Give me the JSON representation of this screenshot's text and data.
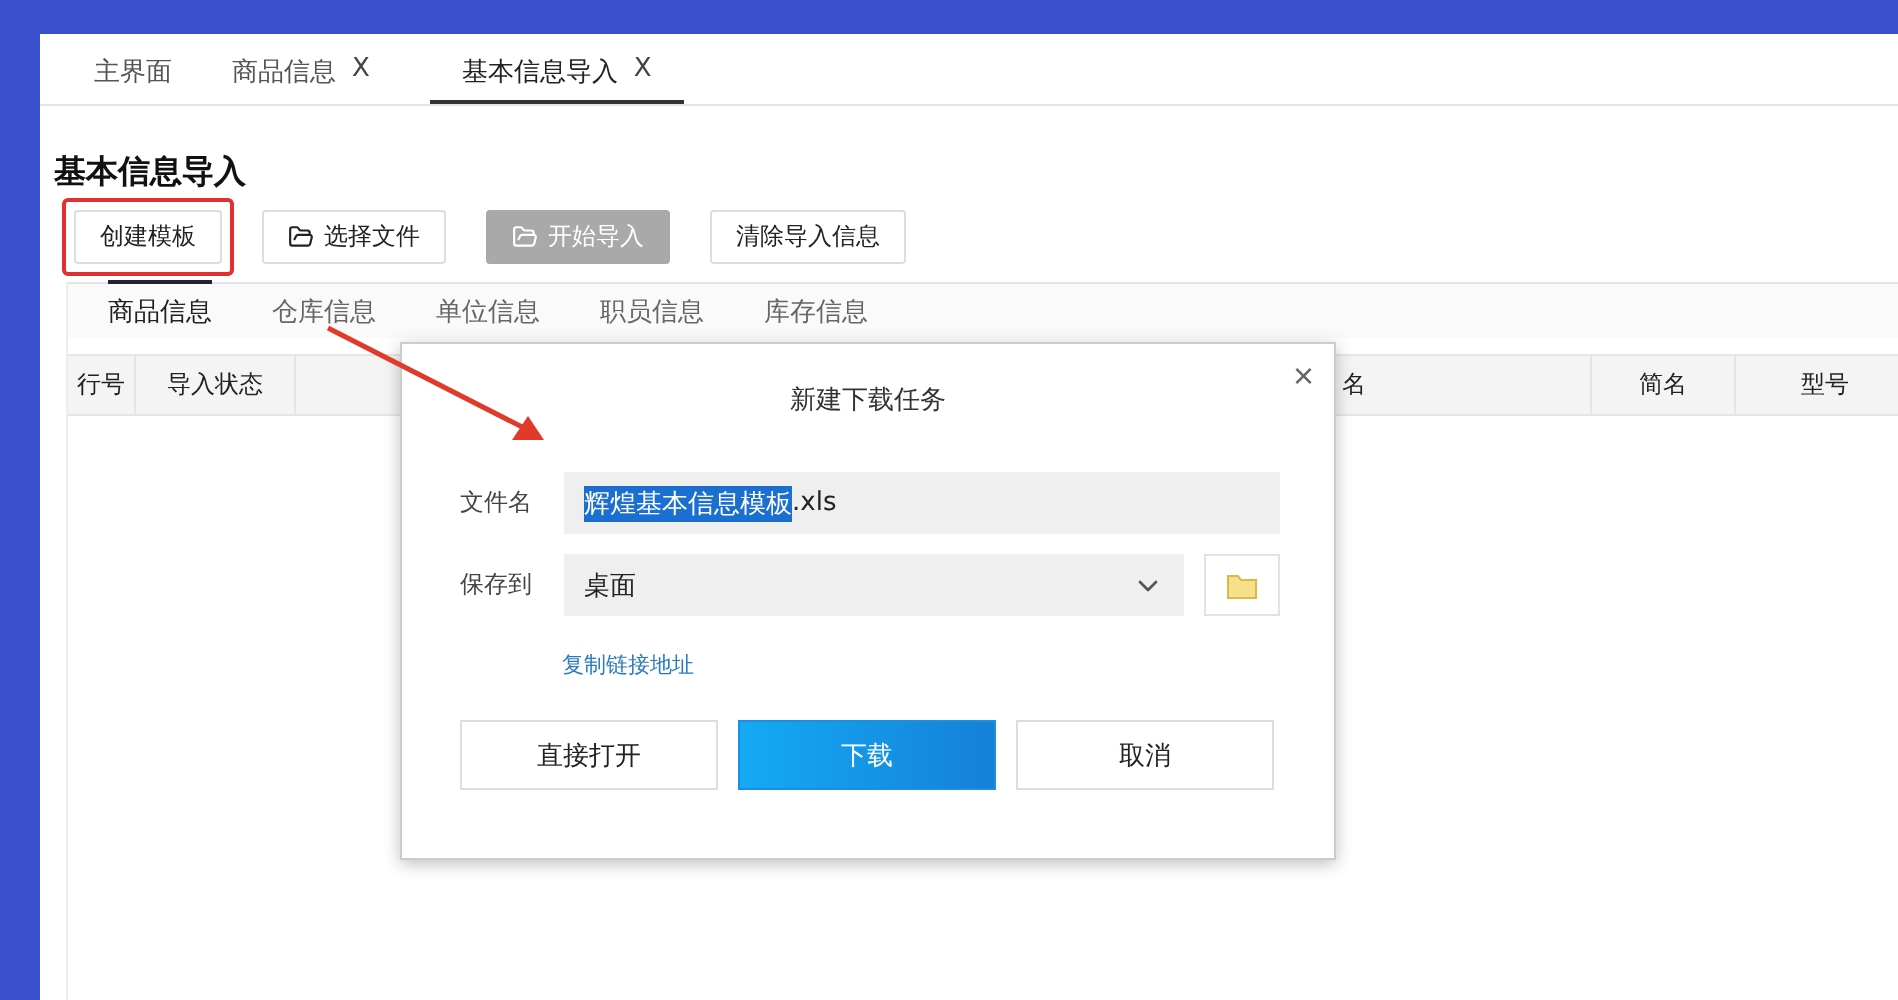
{
  "tabs": [
    {
      "label": "主界面",
      "selected": false
    },
    {
      "label": "商品信息",
      "close": "X",
      "selected": false
    },
    {
      "label": "基本信息导入",
      "close": "X",
      "selected": true
    }
  ],
  "heading": "基本信息导入",
  "toolbar": [
    {
      "label": "创建模板",
      "kind": "plain",
      "disabled": false,
      "highlighted": true
    },
    {
      "label": "选择文件",
      "kind": "folder",
      "disabled": false,
      "highlighted": false
    },
    {
      "label": "开始导入",
      "kind": "folder",
      "disabled": true,
      "highlighted": false
    },
    {
      "label": "清除导入信息",
      "kind": "plain",
      "disabled": false,
      "highlighted": false
    }
  ],
  "subtabs": [
    {
      "label": "商品信息",
      "selected": true
    },
    {
      "label": "仓库信息",
      "selected": false
    },
    {
      "label": "单位信息",
      "selected": false
    },
    {
      "label": "职员信息",
      "selected": false
    },
    {
      "label": "库存信息",
      "selected": false
    }
  ],
  "table": {
    "columns": [
      "行号",
      "导入状态",
      "名",
      "简名",
      "型号"
    ]
  },
  "dialog": {
    "title": "新建下载任务",
    "close": "×",
    "file_label": "文件名",
    "file_selected": "辉煌基本信息模板",
    "file_rest": ".xls",
    "save_label": "保存到",
    "save_value": "桌面",
    "link": "复制链接地址",
    "buttons": [
      {
        "label": "直接打开",
        "kind": "plain"
      },
      {
        "label": "下载",
        "kind": "primary"
      },
      {
        "label": "取消",
        "kind": "plain"
      }
    ]
  }
}
